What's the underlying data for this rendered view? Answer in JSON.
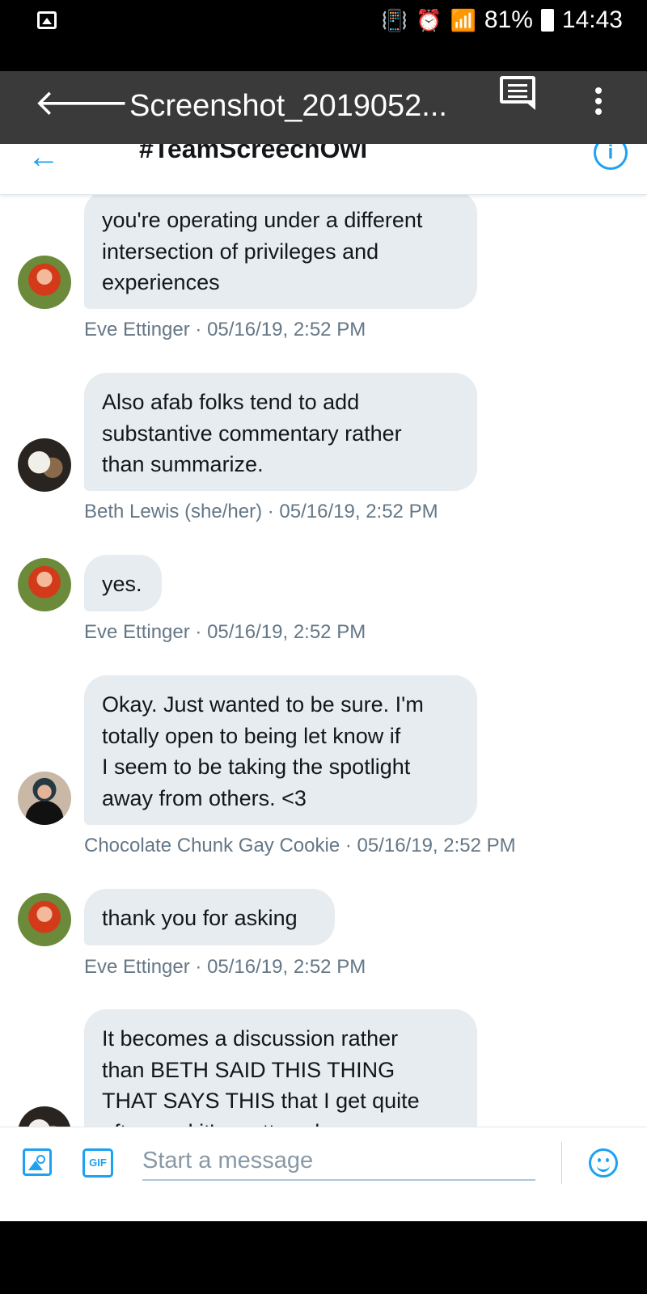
{
  "status_bar": {
    "battery_percent": "81%",
    "time": "14:43",
    "network": "LTE"
  },
  "viewer": {
    "title": "Screenshot_2019052..."
  },
  "conversation": {
    "title": "#TeamScreechOwl"
  },
  "messages": [
    {
      "author": "Eve Ettinger",
      "text": "you're operating under a different\nintersection of privileges and\nexperiences",
      "meta": "Eve Ettinger · 05/16/19, 2:52 PM"
    },
    {
      "author": "Beth Lewis (she/her)",
      "text": "Also afab folks tend to add\nsubstantive commentary rather\nthan summarize.",
      "meta": "Beth Lewis (she/her) · 05/16/19, 2:52 PM"
    },
    {
      "author": "Eve Ettinger",
      "text": "yes.",
      "meta": "Eve Ettinger · 05/16/19, 2:52 PM"
    },
    {
      "author": "Chocolate Chunk Gay Cookie",
      "text": "Okay. Just wanted to be sure. I'm\ntotally open to being let know if\nI seem to be taking the spotlight\naway from others. <3",
      "meta": "Chocolate Chunk Gay Cookie · 05/16/19, 2:52 PM"
    },
    {
      "author": "Eve Ettinger",
      "text": "thank you for asking",
      "meta": "Eve Ettinger · 05/16/19, 2:52 PM"
    },
    {
      "author": "Beth Lewis (she/her)",
      "text": "It becomes a discussion rather\nthan BETH SAID THIS THING\nTHAT SAYS THIS that I get quite\noften and it's pretty exhaus",
      "meta": ""
    }
  ],
  "composer": {
    "placeholder": "Start a message",
    "gif_label": "GIF"
  }
}
